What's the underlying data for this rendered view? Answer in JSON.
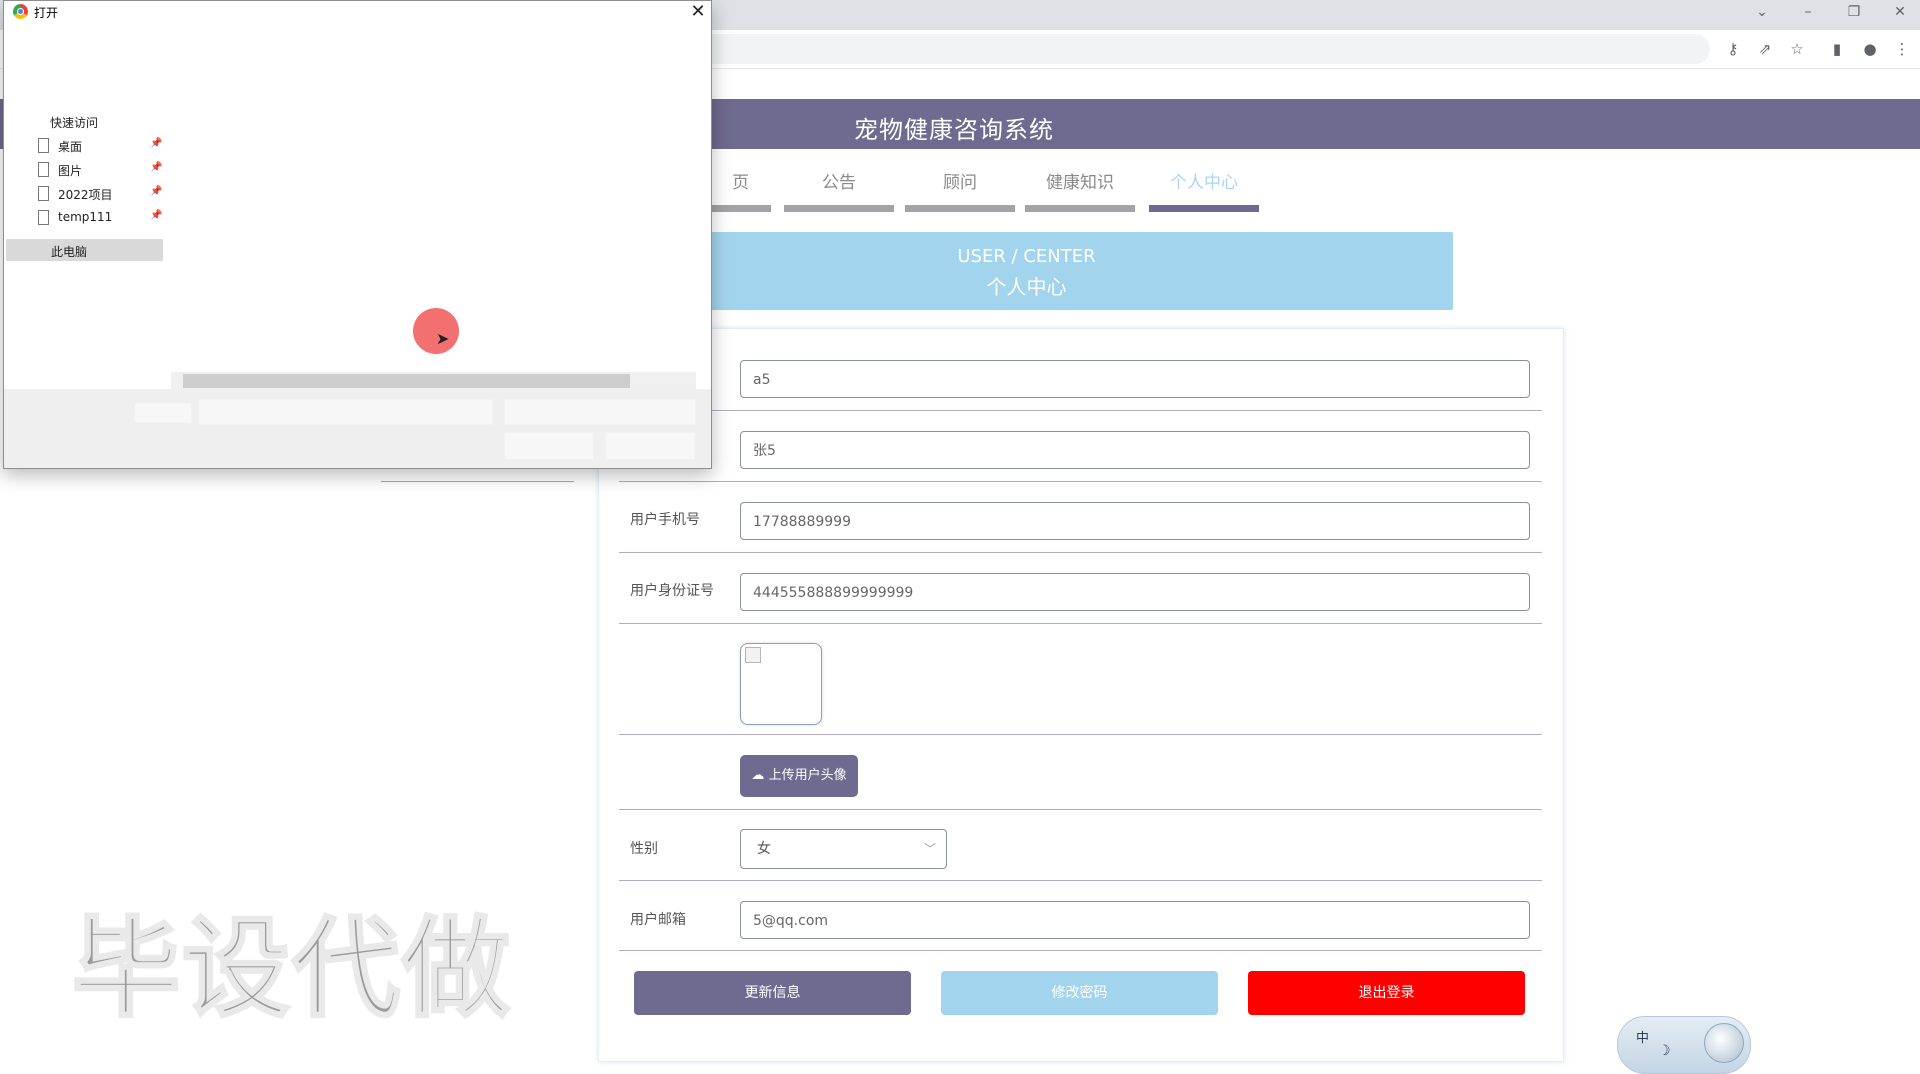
{
  "site": {
    "title": "宠物健康咨询系统"
  },
  "nav": [
    {
      "label": "首页",
      "visible_label": "页",
      "active": false
    },
    {
      "label": "公告",
      "active": false
    },
    {
      "label": "顾问",
      "active": false
    },
    {
      "label": "健康知识",
      "active": false
    },
    {
      "label": "个人中心",
      "active": true
    }
  ],
  "banner": {
    "en": "USER / CENTER",
    "cn": "个人中心"
  },
  "form": {
    "account": {
      "value": "a5"
    },
    "name": {
      "value": "张5"
    },
    "phone": {
      "label": "用户手机号",
      "value": "17788889999"
    },
    "idcard": {
      "label": "用户身份证号",
      "value": "444555888899999999"
    },
    "upload_label": "上传用户头像",
    "gender": {
      "label": "性别",
      "value": "女"
    },
    "email": {
      "label": "用户邮箱",
      "value": "5@qq.com"
    }
  },
  "buttons": {
    "update": "更新信息",
    "password": "修改密码",
    "logout": "退出登录"
  },
  "watermark": "毕设代做",
  "ime": {
    "mode": "中"
  },
  "dialog": {
    "title": "打开",
    "quick_access": "快速访问",
    "items": [
      {
        "label": "桌面"
      },
      {
        "label": "图片"
      },
      {
        "label": "2022项目"
      },
      {
        "label": "temp111"
      }
    ],
    "this_pc": "此电脑"
  },
  "icons": {
    "close": "close-icon",
    "pin": "pin-icon",
    "cloud_upload": "cloud-upload-icon",
    "chevron": "chevron-down-icon"
  },
  "colors": {
    "header": "#6f6a8f",
    "banner": "#a3d4ee",
    "logout": "#ff0000"
  }
}
